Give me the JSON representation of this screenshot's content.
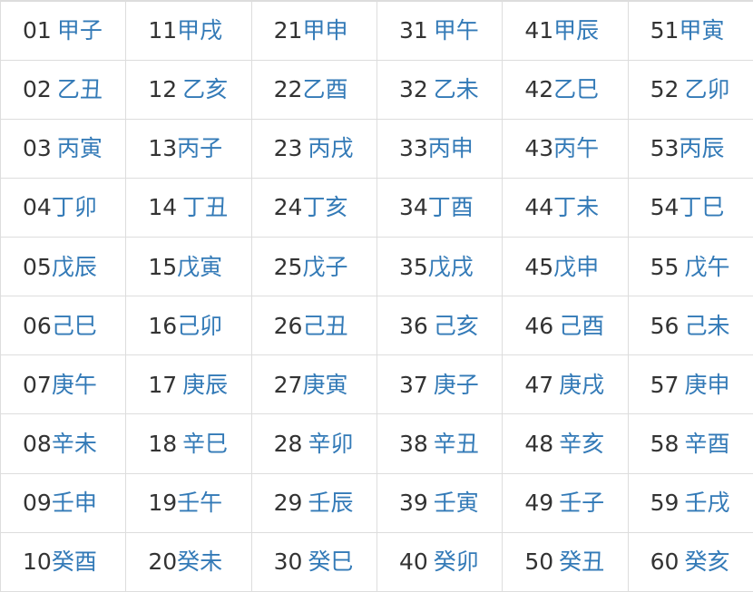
{
  "rows": [
    [
      {
        "num": "01",
        "name": "甲子",
        "gap": true
      },
      {
        "num": "11",
        "name": "甲戌",
        "gap": false
      },
      {
        "num": "21",
        "name": "甲申",
        "gap": false
      },
      {
        "num": "31",
        "name": "甲午",
        "gap": true
      },
      {
        "num": "41",
        "name": "甲辰",
        "gap": false
      },
      {
        "num": "51",
        "name": "甲寅",
        "gap": false
      }
    ],
    [
      {
        "num": "02",
        "name": "乙丑",
        "gap": true
      },
      {
        "num": "12",
        "name": "乙亥",
        "gap": true
      },
      {
        "num": "22",
        "name": "乙酉",
        "gap": false
      },
      {
        "num": "32",
        "name": "乙未",
        "gap": true
      },
      {
        "num": "42",
        "name": "乙巳",
        "gap": false
      },
      {
        "num": "52",
        "name": "乙卯",
        "gap": true
      }
    ],
    [
      {
        "num": "03",
        "name": "丙寅",
        "gap": true
      },
      {
        "num": "13",
        "name": "丙子",
        "gap": false
      },
      {
        "num": "23",
        "name": "丙戌",
        "gap": true
      },
      {
        "num": "33",
        "name": "丙申",
        "gap": false
      },
      {
        "num": "43",
        "name": "丙午",
        "gap": false
      },
      {
        "num": "53",
        "name": "丙辰",
        "gap": false
      }
    ],
    [
      {
        "num": "04",
        "name": "丁卯",
        "gap": false
      },
      {
        "num": "14",
        "name": "丁丑",
        "gap": true
      },
      {
        "num": "24",
        "name": "丁亥",
        "gap": false
      },
      {
        "num": "34",
        "name": "丁酉",
        "gap": false
      },
      {
        "num": "44",
        "name": "丁未",
        "gap": false
      },
      {
        "num": "54",
        "name": "丁巳",
        "gap": false
      }
    ],
    [
      {
        "num": "05",
        "name": "戊辰",
        "gap": false
      },
      {
        "num": "15",
        "name": "戊寅",
        "gap": false
      },
      {
        "num": "25",
        "name": "戊子",
        "gap": false
      },
      {
        "num": "35",
        "name": "戊戌",
        "gap": false
      },
      {
        "num": "45",
        "name": "戊申",
        "gap": false
      },
      {
        "num": "55",
        "name": "戊午",
        "gap": true
      }
    ],
    [
      {
        "num": "06",
        "name": "己巳",
        "gap": false
      },
      {
        "num": "16",
        "name": "己卯",
        "gap": false
      },
      {
        "num": "26",
        "name": "己丑",
        "gap": false
      },
      {
        "num": "36",
        "name": "己亥",
        "gap": true
      },
      {
        "num": "46",
        "name": "己酉",
        "gap": true
      },
      {
        "num": "56",
        "name": "己未",
        "gap": true
      }
    ],
    [
      {
        "num": "07",
        "name": "庚午",
        "gap": false
      },
      {
        "num": "17",
        "name": "庚辰",
        "gap": true
      },
      {
        "num": "27",
        "name": "庚寅",
        "gap": false
      },
      {
        "num": "37",
        "name": "庚子",
        "gap": true
      },
      {
        "num": "47",
        "name": "庚戌",
        "gap": true
      },
      {
        "num": "57",
        "name": "庚申",
        "gap": true
      }
    ],
    [
      {
        "num": "08",
        "name": "辛未",
        "gap": false
      },
      {
        "num": "18",
        "name": "辛巳",
        "gap": true
      },
      {
        "num": "28",
        "name": "辛卯",
        "gap": true
      },
      {
        "num": "38",
        "name": "辛丑",
        "gap": true
      },
      {
        "num": "48",
        "name": "辛亥",
        "gap": true
      },
      {
        "num": "58",
        "name": "辛酉",
        "gap": true
      }
    ],
    [
      {
        "num": "09",
        "name": "壬申",
        "gap": false
      },
      {
        "num": "19",
        "name": "壬午",
        "gap": false
      },
      {
        "num": "29",
        "name": "壬辰",
        "gap": true
      },
      {
        "num": "39",
        "name": "壬寅",
        "gap": true
      },
      {
        "num": "49",
        "name": "壬子",
        "gap": true
      },
      {
        "num": "59",
        "name": "壬戌",
        "gap": true
      }
    ],
    [
      {
        "num": "10",
        "name": "癸酉",
        "gap": false
      },
      {
        "num": "20",
        "name": "癸未",
        "gap": false
      },
      {
        "num": "30",
        "name": "癸巳",
        "gap": true
      },
      {
        "num": "40",
        "name": "癸卯",
        "gap": true
      },
      {
        "num": "50",
        "name": "癸丑",
        "gap": true
      },
      {
        "num": "60",
        "name": "癸亥",
        "gap": true
      }
    ]
  ],
  "colors": {
    "number_text": "#333333",
    "link_text": "#337ab7",
    "border": "#dddddd",
    "background": "#ffffff"
  }
}
